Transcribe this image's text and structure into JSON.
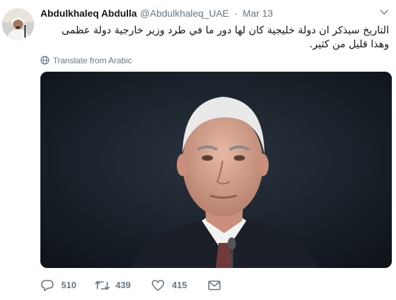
{
  "tweet": {
    "author_name": "Abdulkhaleq Abdulla",
    "handle": "@Abdulkhaleq_UAE",
    "separator": "·",
    "date": "Mar 13",
    "text": "التاريخ سيذكر ان دولة خليجية كان لها دور ما في طرد وزير خارجية دولة عظمى وهذا قليل من كثير.",
    "translate_label": "Translate from Arabic"
  },
  "actions": {
    "replies": "510",
    "retweets": "439",
    "likes": "415"
  },
  "icons": {
    "caret": "chevron-down-icon",
    "translate": "globe-icon",
    "reply": "reply-icon",
    "retweet": "retweet-icon",
    "like": "heart-icon",
    "message": "envelope-icon"
  },
  "colors": {
    "text": "#14171a",
    "secondary": "#657786"
  }
}
